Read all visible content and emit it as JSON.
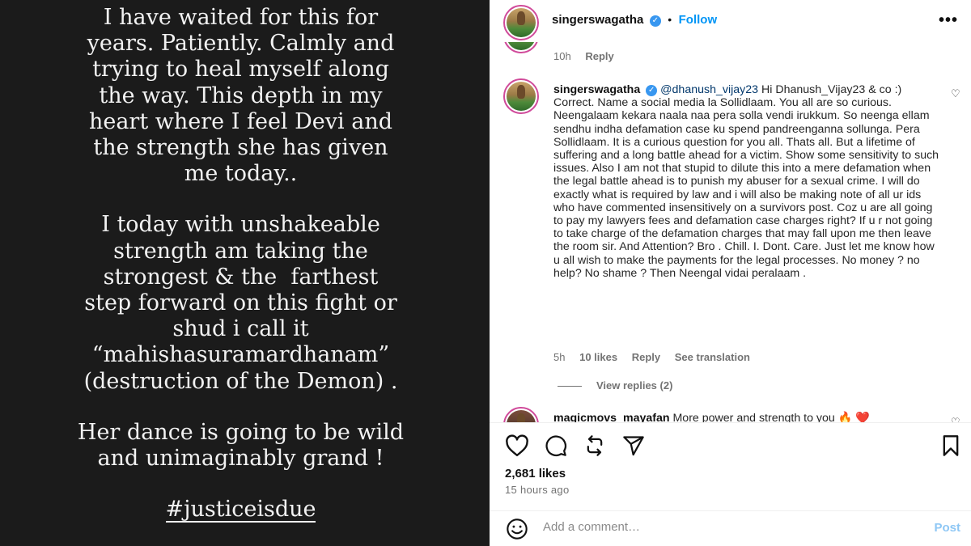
{
  "story": {
    "paragraph1": [
      "I have waited for this for",
      "years. Patiently. Calmly and",
      "trying to heal myself along",
      "the way. This depth in my",
      "heart where I feel Devi and",
      "the strength she has given",
      "me today.."
    ],
    "paragraph2": [
      "I today with unshakeable",
      "strength am taking the",
      "strongest & the  farthest",
      "step forward on this fight or",
      "shud i call it",
      "“mahishasuramardhanam”",
      "(destruction of the Demon) ."
    ],
    "paragraph3": [
      "Her dance is going to be wild",
      "and unimaginably grand !"
    ],
    "hashtag": "#justiceisdue"
  },
  "header": {
    "username": "singerswagatha",
    "verified_icon": "verified-badge-icon",
    "follow_label": "Follow",
    "more_icon": "more-options-icon"
  },
  "prev_comment": {
    "time": "10h",
    "reply_label": "Reply"
  },
  "main_comment": {
    "username": "singerswagatha",
    "mention": "@dhanush_vijay23",
    "text": "Hi Dhanush_Vijay23 & co :) Correct. Name a social media la Sollidlaam. You all are so curious. Neengalaam kekara naala naa pera solla vendi irukkum. So neenga ellam sendhu indha defamation case ku spend pandreenganna sollunga. Pera Sollidlaam. It is a curious question for you all. Thats all. But a lifetime of suffering and a long battle ahead for a victim. Show some sensitivity to such issues. Also I am not that stupid to dilute this into a mere defamation when the legal battle ahead is to punish my abuser for a sexual crime. I will do exactly what is required by law and i will also be making note of all ur ids who have commented insensitively on a survivors post. Coz u are all going to pay my lawyers fees and defamation case charges right? If u r not going to take charge of the defamation charges that may fall upon me then leave the room sir. And Attention? Bro . Chill. I. Dont. Care. Just let me know how u all wish to make the payments for the legal processes. No money ? no help? No shame ? Then Neengal vidai peralaam .",
    "time": "5h",
    "likes": "10 likes",
    "reply_label": "Reply",
    "translate_label": "See translation",
    "view_replies": "View replies (2)"
  },
  "next_comment": {
    "username": "magicmovs_mayafan",
    "text": "More power and strength to you 🔥 ❤️"
  },
  "actions": {
    "likes": "2,681 likes",
    "time": "15 hours ago",
    "add_comment_placeholder": "Add a comment…",
    "post_label": "Post"
  }
}
